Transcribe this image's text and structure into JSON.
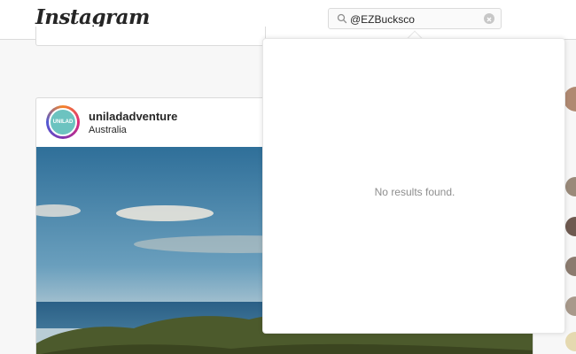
{
  "header": {
    "logo_text": "Instagram",
    "search": {
      "value": "@EZBucksco",
      "icon": "search-icon",
      "clear_icon": "clear-icon"
    }
  },
  "post": {
    "avatar_text": "UNILAD",
    "username": "uniladadventure",
    "location": "Australia"
  },
  "search_results": {
    "message": "No results found."
  },
  "colors": {
    "header_bg": "#ffffff",
    "border": "#dbdbdb",
    "muted_text": "#8e8e8e",
    "avatar_bg": "#6cc3c0"
  }
}
